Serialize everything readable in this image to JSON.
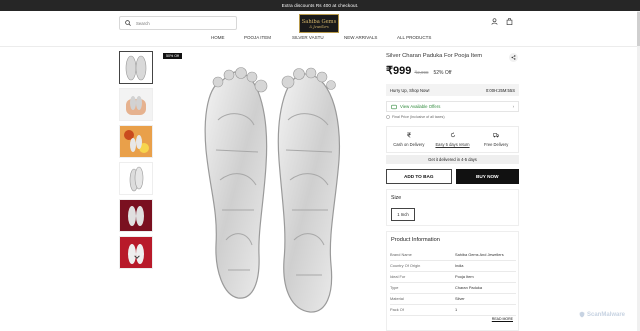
{
  "announcement": "Extra discounts Rs 400 at checkout.",
  "header": {
    "search_placeholder": "Search",
    "logo_line1": "Sahiba Gems",
    "logo_line2": "& Jewellers"
  },
  "nav": [
    "HOME",
    "POOJA ITEM",
    "SILVER VASTU",
    "NEW ARRIVALS",
    "ALL PRODUCTS"
  ],
  "gallery": {
    "sale_badge": "50% Off",
    "thumbnails": [
      "paduka-front",
      "paduka-in-hand",
      "paduka-on-decor",
      "paduka-side",
      "paduka-on-red-cloth",
      "paduka-pair-red"
    ]
  },
  "product": {
    "title": "Silver Charan Paduka For Pooja Item",
    "price": "₹999",
    "mrp": "₹2,098",
    "discount": "52% Off",
    "hurry_text": "Hurry Up, Shop Now!",
    "timer": "0:00H:25M:55S",
    "offers_label": "View Available Offers",
    "tax_note": "Final Price (Inclusive of all taxes)",
    "benefits": [
      {
        "label": "Cash on Delivery",
        "icon": "rupee-icon"
      },
      {
        "label": "Easy 5 days return",
        "icon": "return-icon"
      },
      {
        "label": "Free Delivery",
        "icon": "truck-icon"
      }
    ],
    "delivery_text": "Get it delivered in 4-5 days",
    "add_to_bag": "ADD TO BAG",
    "buy_now": "BUY NOW",
    "size_label": "Size",
    "size_option": "1 Inch"
  },
  "information": {
    "title": "Product Information",
    "rows": [
      [
        "Brand Name",
        "Sahiba Gems And Jewellers"
      ],
      [
        "Country Of Origin",
        "India"
      ],
      [
        "Ideal For",
        "Pooja Item"
      ],
      [
        "Type",
        "Charan Paduka"
      ],
      [
        "Material",
        "Silver"
      ],
      [
        "Pack Of",
        "1"
      ]
    ],
    "read_more": "READ MORE"
  },
  "watermark": "ScanMalware"
}
